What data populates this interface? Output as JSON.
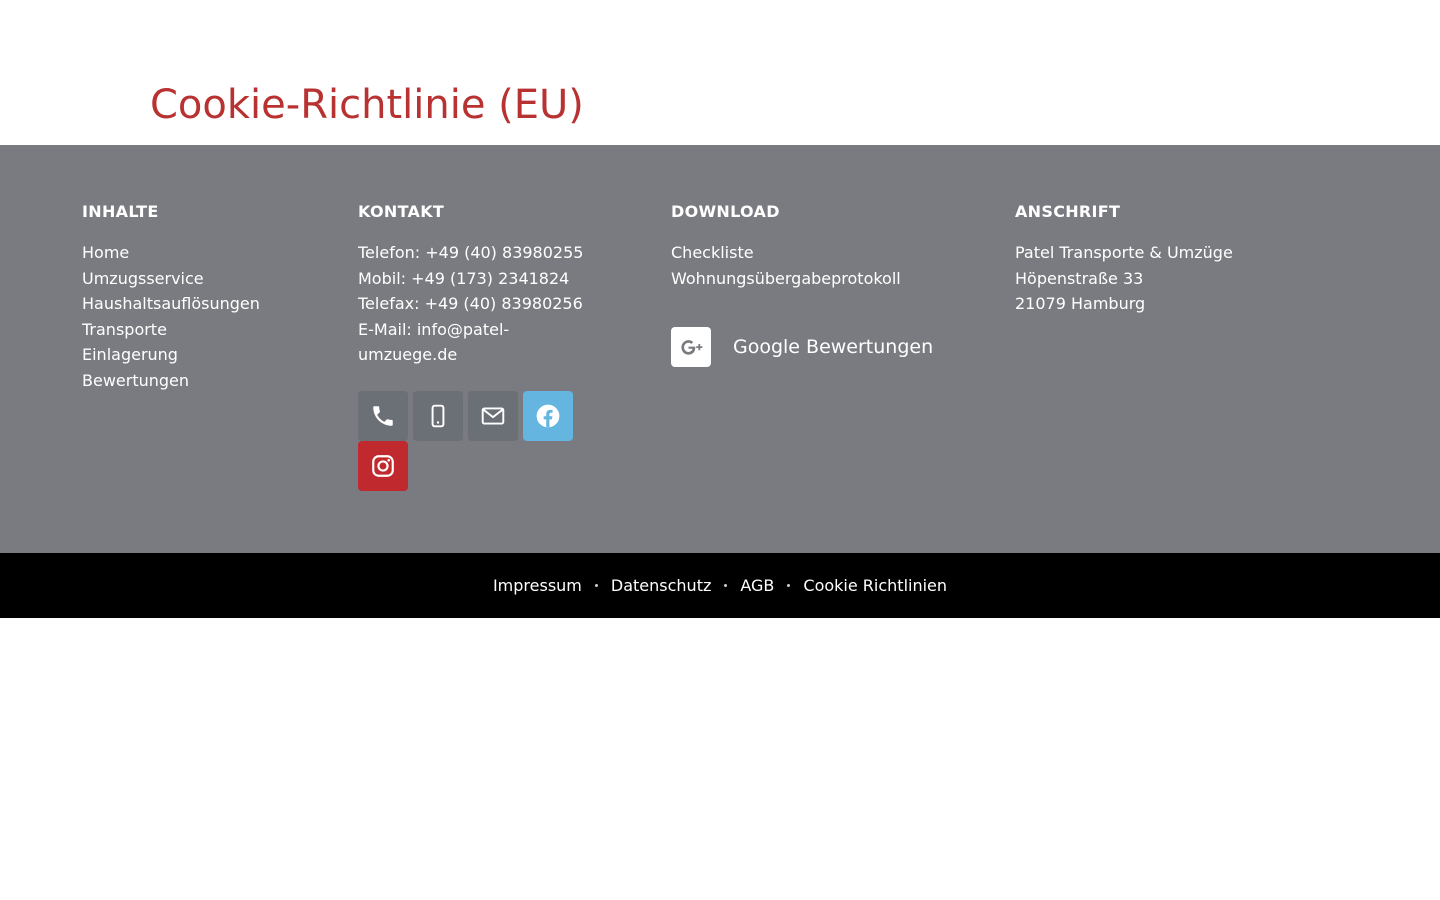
{
  "page": {
    "title": "Cookie-Richtlinie (EU)"
  },
  "footer": {
    "inhalte": {
      "heading": "INHALTE",
      "links": [
        "Home",
        "Umzugsservice",
        "Haushaltsauflösungen",
        "Transporte",
        "Einlagerung",
        "Bewertungen"
      ]
    },
    "kontakt": {
      "heading": "KONTAKT",
      "telefon": "Telefon: +49 (40) 83980255",
      "mobil": "Mobil: +49 (173) 2341824",
      "telefax": "Telefax: +49 (40) 83980256",
      "email": "E-Mail: info@patel-umzuege.de",
      "social_icons": [
        "phone-icon",
        "mobile-icon",
        "envelope-icon",
        "facebook-icon",
        "instagram-icon"
      ]
    },
    "download": {
      "heading": "DOWNLOAD",
      "links": [
        "Checkliste",
        "Wohnungsübergabeprotokoll"
      ],
      "google_review_label": "Google Bewertungen"
    },
    "anschrift": {
      "heading": "ANSCHRIFT",
      "lines": [
        "Patel Transporte & Umzüge",
        "Höpenstraße 33",
        "21079 Hamburg"
      ]
    },
    "bottom_links": [
      "Impressum",
      "Datenschutz",
      "AGB",
      "Cookie Richtlinien"
    ]
  },
  "colors": {
    "title": "#b83232",
    "footer_bg": "#7a7b80",
    "bottom_bar_bg": "#000000",
    "social_grey": "#6b6f76",
    "facebook": "#64b6e0",
    "instagram": "#c0292e"
  }
}
